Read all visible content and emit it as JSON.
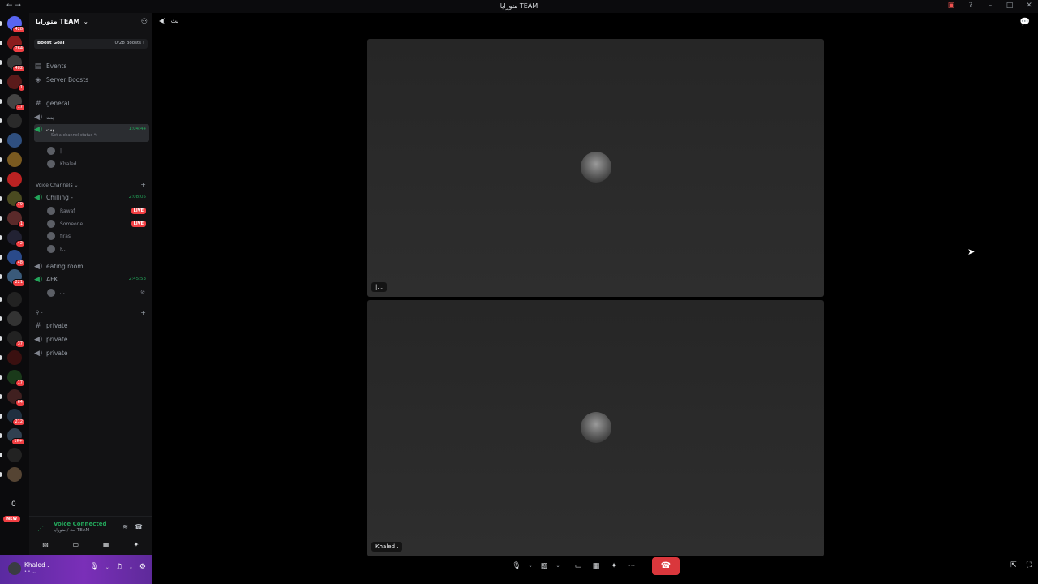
{
  "window": {
    "title": "متورايا TEAM",
    "nav": "← →"
  },
  "rail": {
    "servers": [
      {
        "badge": "428"
      },
      {
        "badge": "264"
      },
      {
        "badge": "482"
      },
      {
        "badge": "1"
      },
      {
        "badge": "17"
      },
      {
        "badge": ""
      },
      {
        "badge": ""
      },
      {
        "badge": ""
      },
      {
        "badge": ""
      },
      {
        "badge": "79"
      },
      {
        "badge": "1"
      },
      {
        "badge": "42"
      },
      {
        "badge": "48"
      },
      {
        "badge": "221"
      },
      {
        "badge": ""
      },
      {
        "badge": ""
      },
      {
        "badge": "37"
      },
      {
        "badge": ""
      },
      {
        "badge": "17"
      },
      {
        "badge": "64"
      },
      {
        "badge": "212"
      },
      {
        "badge": "1K+"
      },
      {
        "badge": ""
      },
      {
        "badge": ""
      }
    ],
    "zero_label": "0",
    "new_label": "NEW"
  },
  "sidebar": {
    "server_name": "متورايا TEAM",
    "boost_label": "Boost Goal",
    "boost_count": "0/28 Boosts",
    "events": "Events",
    "server_boosts": "Server Boosts",
    "general": "general",
    "voice1": "بث",
    "selected_channel": "بث",
    "selected_timer": "1:04:44",
    "channel_status": "Set a channel status",
    "sel_users": [
      "|...",
      "Khaled ."
    ],
    "category": "Voice Channels",
    "chilling": "Chilling -",
    "chilling_timer": "2:08:05",
    "chilling_users": [
      "Rawaf",
      "Someone...",
      "firas",
      "F..."
    ],
    "live": "LIVE",
    "eating": "eating room",
    "afk": "AFK",
    "afk_timer": "2:45:53",
    "afk_user": "ب...",
    "cat2": "-",
    "private1": "private",
    "private2": "private",
    "private3": "private"
  },
  "voice_panel": {
    "title": "Voice Connected",
    "subtitle": "بث / متورايا TEAM"
  },
  "userbar": {
    "name": "Khaled .",
    "status": "• • ..."
  },
  "stage": {
    "channel": "بث",
    "tile1_name": "|...",
    "tile2_name": "Khaled ."
  }
}
